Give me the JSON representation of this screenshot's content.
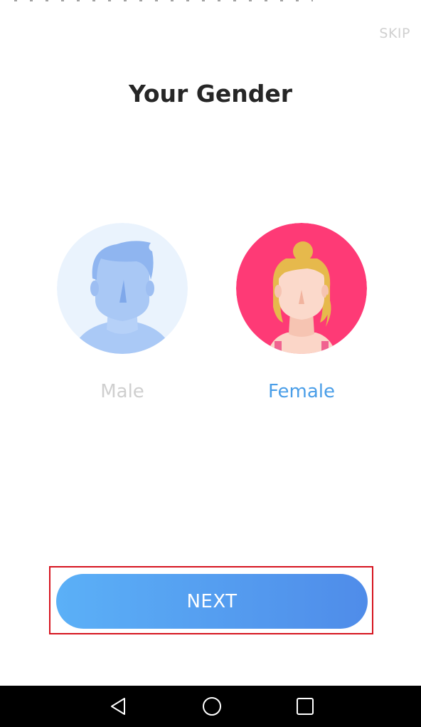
{
  "header": {
    "skip_label": "SKIP",
    "title": "Your Gender"
  },
  "options": [
    {
      "label": "Male",
      "selected": false,
      "icon": "male-avatar-icon"
    },
    {
      "label": "Female",
      "selected": true,
      "icon": "female-avatar-icon"
    }
  ],
  "footer": {
    "next_label": "NEXT"
  },
  "colors": {
    "accent": "#4a9ee8",
    "female_circle": "#fe3a76",
    "male_circle": "#eaf3fd",
    "button_start": "#5bb0f7",
    "button_end": "#4f8ce9",
    "highlight": "#d6141f"
  },
  "system_nav": {
    "icons": [
      "back-icon",
      "home-icon",
      "recent-apps-icon"
    ]
  }
}
